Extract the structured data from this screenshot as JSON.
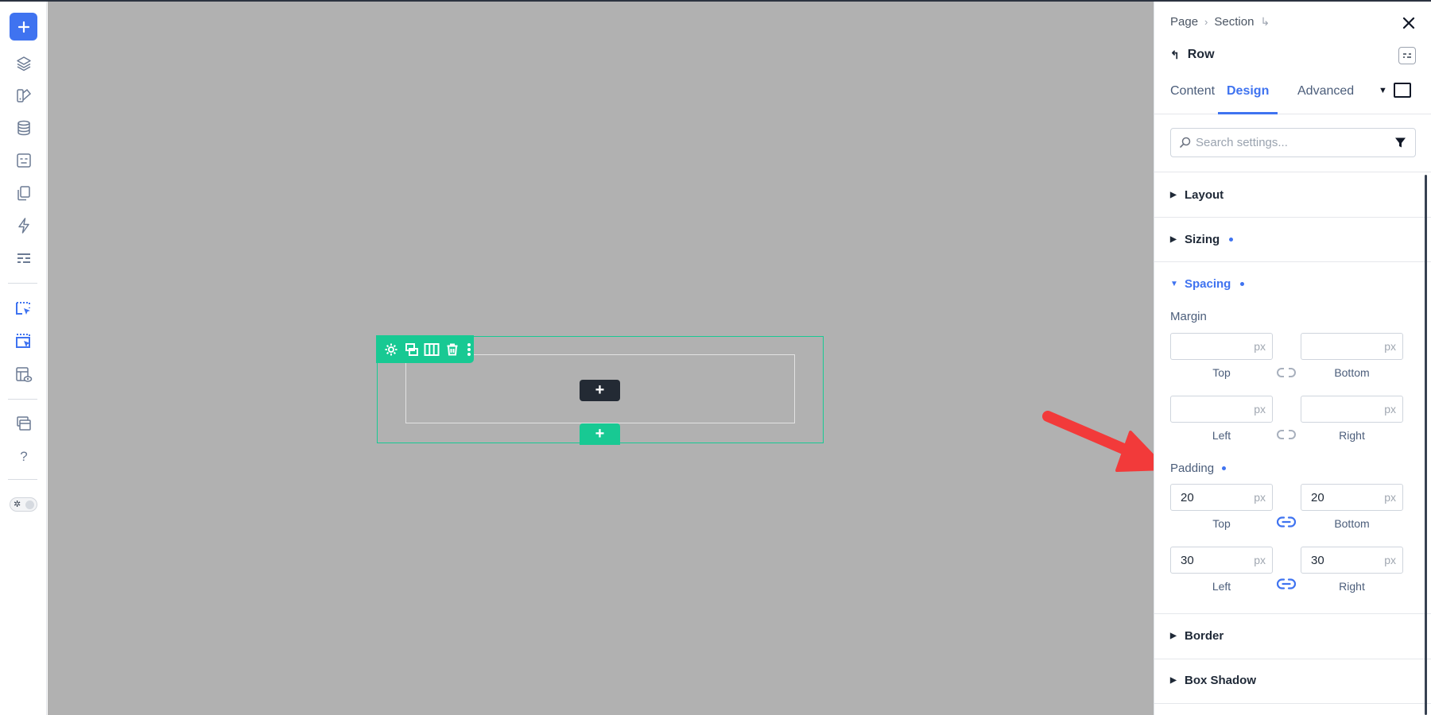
{
  "left_toolbar": {
    "icons": [
      "plus-icon",
      "layers-icon",
      "shapes-icon",
      "database-icon",
      "template-icon",
      "pages-icon",
      "lightning-icon",
      "form-icon",
      "select-element-icon",
      "select-parent-icon",
      "preview-icon",
      "windows-icon",
      "help-icon",
      "theme-toggle"
    ],
    "help_label": "?",
    "accent": "#3f73f0"
  },
  "canvas": {
    "background": "#b1b1b1",
    "row_accent": "#18c993",
    "add_label": "+",
    "toolbar_icons": [
      "gear-icon",
      "duplicate-icon",
      "columns-icon",
      "trash-icon",
      "more-icon"
    ]
  },
  "panel": {
    "breadcrumb": [
      "Page",
      "Section"
    ],
    "element_title": "Row",
    "tabs": [
      {
        "label": "Content",
        "active": false
      },
      {
        "label": "Design",
        "active": true
      },
      {
        "label": "Advanced",
        "active": false
      }
    ],
    "search_placeholder": "Search settings...",
    "sections": {
      "layout": {
        "label": "Layout"
      },
      "sizing": {
        "label": "Sizing",
        "modified": true
      },
      "spacing": {
        "label": "Spacing",
        "modified": true,
        "open": true
      },
      "border": {
        "label": "Border"
      },
      "box_shadow": {
        "label": "Box Shadow"
      }
    },
    "margin": {
      "label": "Margin",
      "top": {
        "value": "",
        "unit": "px",
        "label": "Top"
      },
      "bottom": {
        "value": "",
        "unit": "px",
        "label": "Bottom"
      },
      "left": {
        "value": "",
        "unit": "px",
        "label": "Left"
      },
      "right": {
        "value": "",
        "unit": "px",
        "label": "Right"
      },
      "linked": false
    },
    "padding": {
      "label": "Padding",
      "top": {
        "value": "20",
        "unit": "px",
        "label": "Top"
      },
      "bottom": {
        "value": "20",
        "unit": "px",
        "label": "Bottom"
      },
      "left": {
        "value": "30",
        "unit": "px",
        "label": "Left"
      },
      "right": {
        "value": "30",
        "unit": "px",
        "label": "Right"
      },
      "linked": true
    }
  },
  "annotation": {
    "color": "#f23a3a"
  }
}
